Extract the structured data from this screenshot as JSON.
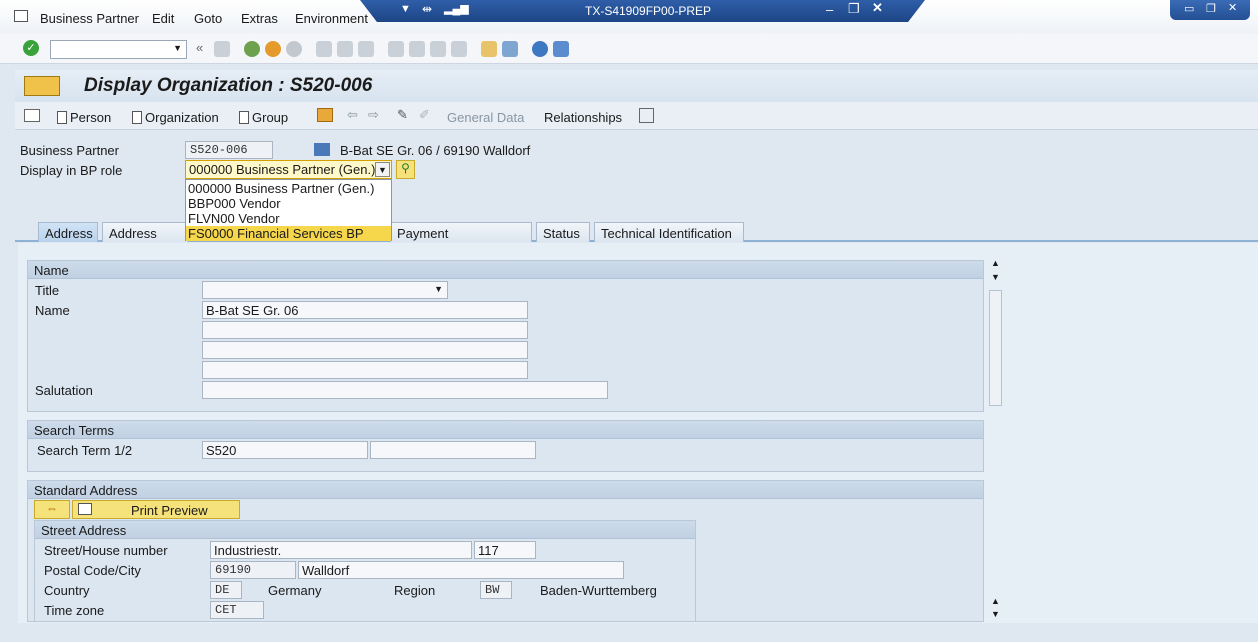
{
  "menubar": {
    "items": [
      "Business Partner",
      "Edit",
      "Goto",
      "Extras",
      "Environment"
    ]
  },
  "window": {
    "system_title": "TX-S41909FP00-PREP"
  },
  "title": "Display Organization : S520-006",
  "app_toolbar": {
    "person": "Person",
    "organization": "Organization",
    "group": "Group",
    "general_data": "General Data",
    "relationships": "Relationships"
  },
  "header": {
    "bp_label": "Business Partner",
    "bp_value": "S520-006",
    "bp_desc": "B-Bat SE Gr. 06 / 69190 Walldorf",
    "role_label": "Display in BP role",
    "role_value": "000000 Business Partner (Gen.)"
  },
  "role_options": [
    {
      "label": "000000 Business Partner (Gen.)",
      "highlighted": false
    },
    {
      "label": "BBP000 Vendor",
      "highlighted": false
    },
    {
      "label": "FLVN00 Vendor",
      "highlighted": false
    },
    {
      "label": "FS0000 Financial Services BP",
      "highlighted": true
    }
  ],
  "tabs": [
    "Address",
    "Address Over",
    "Payment Transactions",
    "Status",
    "Technical Identification"
  ],
  "name_section": {
    "title": "Name",
    "title_label": "Title",
    "name_label": "Name",
    "name_value": "B-Bat SE Gr. 06",
    "salutation_label": "Salutation"
  },
  "search_section": {
    "title": "Search Terms",
    "label": "Search Term 1/2",
    "value1": "S520",
    "value2": ""
  },
  "std_address": {
    "title": "Standard Address",
    "print_preview": "Print Preview",
    "street_title": "Street Address",
    "street_label": "Street/House number",
    "street_value": "Industriestr.",
    "house_value": "117",
    "postal_label": "Postal Code/City",
    "postal_value": "69190",
    "city_value": "Walldorf",
    "country_label": "Country",
    "country_code": "DE",
    "country_name": "Germany",
    "region_label": "Region",
    "region_code": "BW",
    "region_name": "Baden-Wurttemberg",
    "tz_label": "Time zone",
    "tz_value": "CET"
  },
  "colors": {
    "accent": "#1d4586",
    "highlight": "#f6e27a"
  }
}
